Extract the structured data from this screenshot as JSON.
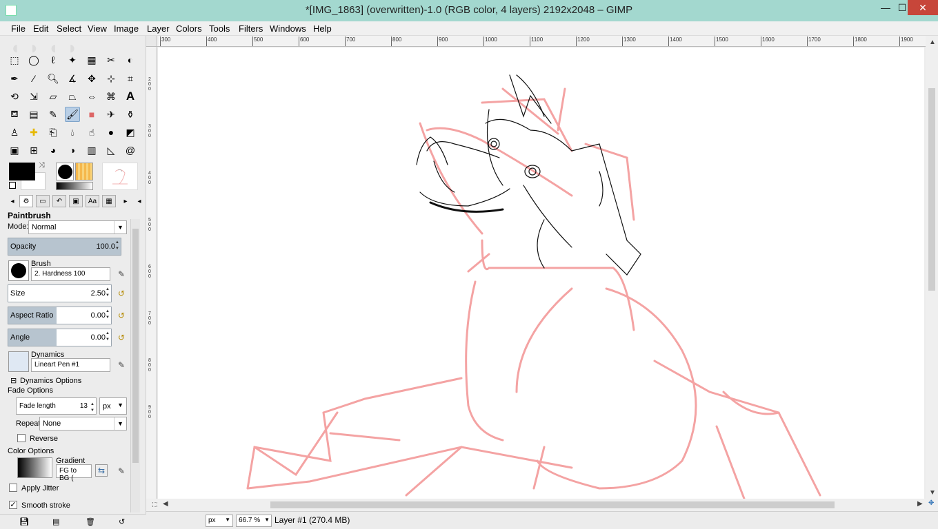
{
  "window": {
    "title": "*[IMG_1863] (overwritten)-1.0 (RGB color, 4 layers) 2192x2048 – GIMP",
    "min_label": "—",
    "max_label": "☐",
    "close_label": "✕"
  },
  "menu": [
    "File",
    "Edit",
    "Select",
    "View",
    "Image",
    "Layer",
    "Colors",
    "Tools",
    "Filters",
    "Windows",
    "Help"
  ],
  "tool_options": {
    "title": "Paintbrush",
    "mode_label": "Mode:",
    "mode_value": "Normal",
    "opacity_label": "Opacity",
    "opacity_value": "100.0",
    "opacity_fraction": 1.0,
    "brush_label": "Brush",
    "brush_value": "2. Hardness 100",
    "size_label": "Size",
    "size_value": "2.50",
    "aspect_label": "Aspect Ratio",
    "aspect_value": "0.00",
    "angle_label": "Angle",
    "angle_value": "0.00",
    "dynamics_label": "Dynamics",
    "dynamics_value": "Lineart Pen #1",
    "dynamics_options_label": "Dynamics Options",
    "fade_options_label": "Fade Options",
    "fade_length_label": "Fade length",
    "fade_length_value": "13",
    "fade_unit": "px",
    "repeat_label": "Repeat:",
    "repeat_value": "None",
    "reverse_label": "Reverse",
    "color_options_label": "Color Options",
    "gradient_label": "Gradient",
    "gradient_value": "FG to BG (",
    "apply_jitter_label": "Apply Jitter",
    "smooth_stroke_label": "Smooth stroke"
  },
  "ruler_labels": [
    "300",
    "400",
    "500",
    "600",
    "700",
    "800",
    "900",
    "1000",
    "1100",
    "1200",
    "1300",
    "1400",
    "1500",
    "1600",
    "1700",
    "1800",
    "1900"
  ],
  "vruler_labels": [
    "2\n0\n0",
    "3\n0\n0",
    "4\n0\n0",
    "5\n0\n0",
    "6\n0\n0",
    "7\n0\n0",
    "8\n0\n0",
    "9\n0\n0"
  ],
  "status": {
    "unit": "px",
    "zoom": "66.7 %",
    "layer_info": "Layer #1 (270.4 MB)"
  }
}
